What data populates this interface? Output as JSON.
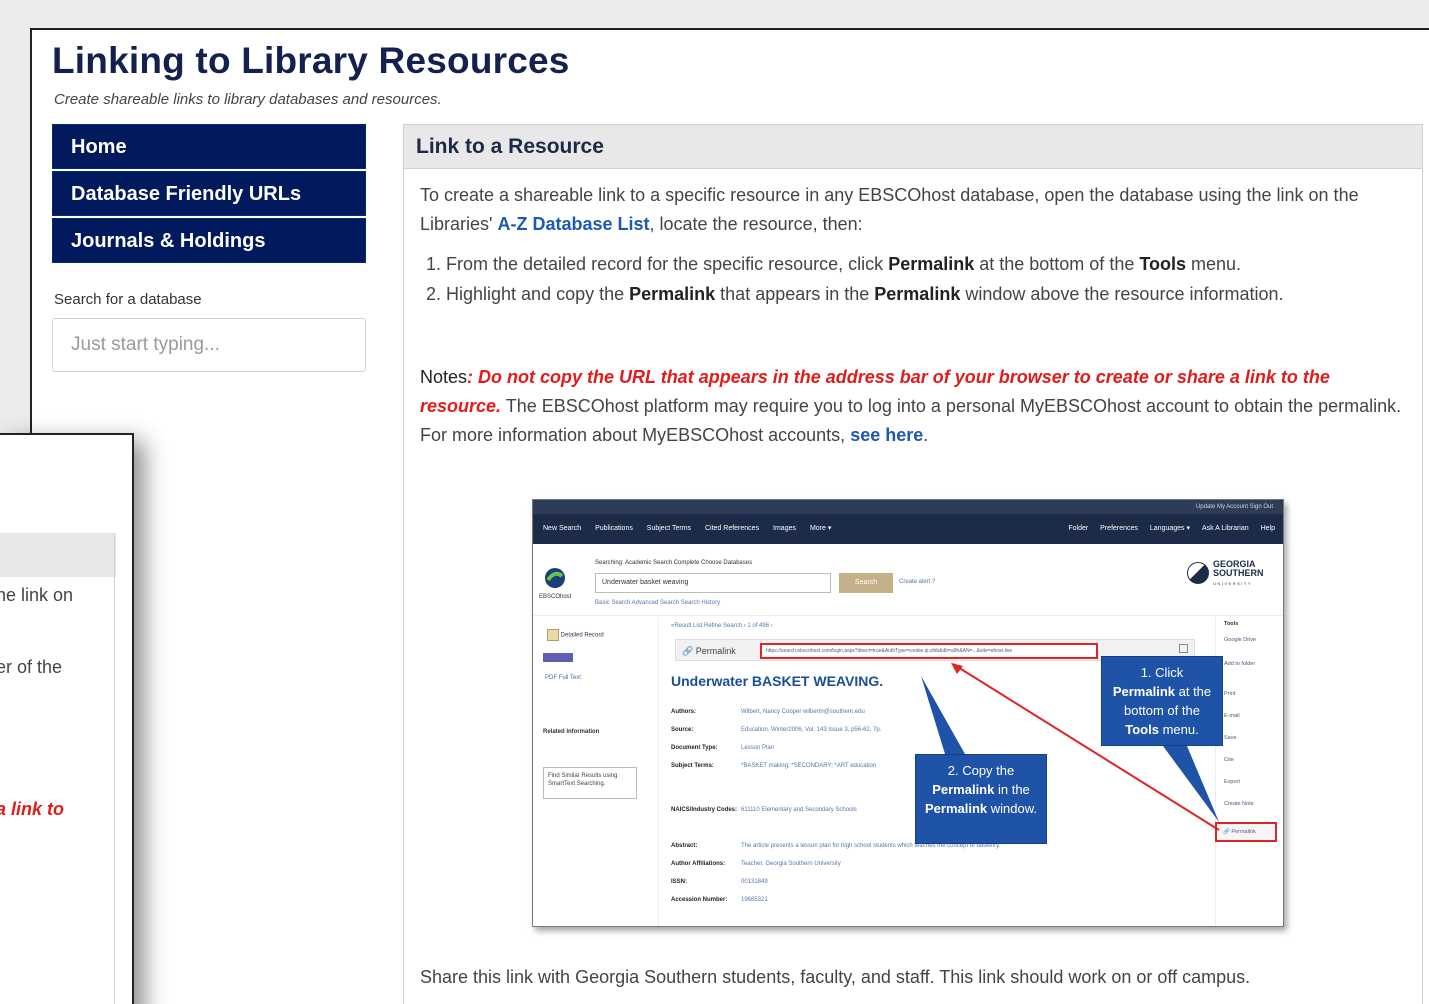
{
  "page": {
    "title": "Linking to Library Resources",
    "subtitle": "Create shareable links to library databases and resources."
  },
  "sidebar": {
    "items": [
      {
        "label": "Home"
      },
      {
        "label": "Database Friendly URLs"
      },
      {
        "label": "Journals & Holdings"
      }
    ],
    "search_label": "Search for a database",
    "search_placeholder": "Just start typing..."
  },
  "panel": {
    "header": "Link to a Resource",
    "intro_before": "To create a shareable link to a specific resource in any EBSCOhost database, open the database using the link on the Libraries' ",
    "intro_link": "A-Z Database List",
    "intro_after": ", locate the resource, then:",
    "step1_a": "From the detailed record for the specific resource, click ",
    "step1_b": "Permalink",
    "step1_c": " at the bottom of the ",
    "step1_d": "Tools",
    "step1_e": " menu.",
    "step2_a": "Highlight and copy the ",
    "step2_b": "Permalink",
    "step2_c": " that appears in the ",
    "step2_d": "Permalink",
    "step2_e": " window above the resource information.",
    "notes_label": "Notes",
    "notes_colon": ": ",
    "notes_warning": "Do not copy the URL that appears in the address bar of your browser to create or share a link to the resource.",
    "notes_text": " The EBSCOhost platform may require you to log into a personal MyEBSCOhost account to obtain the permalink. For more information about MyEBSCOhost accounts, ",
    "notes_link": "see here",
    "notes_end": ".",
    "share_text": "Share this link with Georgia Southern students, faculty, and staff. This link should work on or off campus."
  },
  "ebsco": {
    "topbar": "Update My Account   Sign Out",
    "nav_links": [
      "New Search",
      "Publications",
      "Subject Terms",
      "Cited References",
      "Images",
      "More ▾"
    ],
    "nav_right": [
      "Folder",
      "Preferences",
      "Languages ▾",
      "Ask A Librarian",
      "Help"
    ],
    "logo_text": "EBSCOhost",
    "searching": "Searching: Academic Search Complete   Choose Databases",
    "query": "Underwater basket weaving",
    "search_btn": "Search",
    "create_alert": "Create alert   ?",
    "adv_links": "Basic Search   Advanced Search   Search History",
    "gs_logo_1": "GEORGIA",
    "gs_logo_2": "SOUTHERN",
    "gs_logo_sub": "UNIVERSITY",
    "left_links": [
      "Detailed Record",
      "PDF Full Text",
      "Related Information",
      "Find Similar Results using SmartText Searching."
    ],
    "result_nav": "«Result List   Refine Search   ‹  1 of 496  ›",
    "permalink_label": "Permalink",
    "permalink_url": "https://search.ebscohost.com/login.aspx?direct=true&AuthType=cookie,ip,shib&db=a9h&AN=...&site=ehost-live",
    "article_title": "Underwater BASKET WEAVING.",
    "fields": [
      {
        "label": "Authors:",
        "value": "Wilbert, Nancy Cooper  wilbertn@southern.edu"
      },
      {
        "label": "Source:",
        "value": "Education. Winter2006, Vol. 143 Issue 3, p56-62. 7p."
      },
      {
        "label": "Document Type:",
        "value": "Lesson Plan"
      },
      {
        "label": "Subject Terms:",
        "value": "*BASKET making; *SECONDARY; *ART education"
      },
      {
        "label": "NAICS/Industry Codes:",
        "value": "611110 Elementary and Secondary Schools"
      },
      {
        "label": "Abstract:",
        "value": "The article presents a lesson plan for high school students which teaches the concept of basketry."
      },
      {
        "label": "Author Affiliations:",
        "value": "Teacher, Georgia Southern University"
      },
      {
        "label": "ISSN:",
        "value": "00131849"
      },
      {
        "label": "Accession Number:",
        "value": "19685321"
      }
    ],
    "tools_title": "Tools",
    "tools_items": [
      "Google Drive",
      "Add to folder",
      "Print",
      "E-mail",
      "Save",
      "Cite",
      "Export",
      "Create Note"
    ],
    "tools_permalink": "Permalink",
    "callout1": {
      "line1": "1. Click",
      "bold": "Permalink",
      "line2": " at the bottom of the ",
      "bold2": "Tools",
      "line3": " menu."
    },
    "callout2": {
      "line1": "2. Copy the",
      "bold": "Permalink",
      "line2": " in the ",
      "bold2": "Permalink",
      "line3": " window."
    }
  },
  "back_window": {
    "line1": "he link on",
    "line2": "er of the",
    "line3": "a link to"
  }
}
